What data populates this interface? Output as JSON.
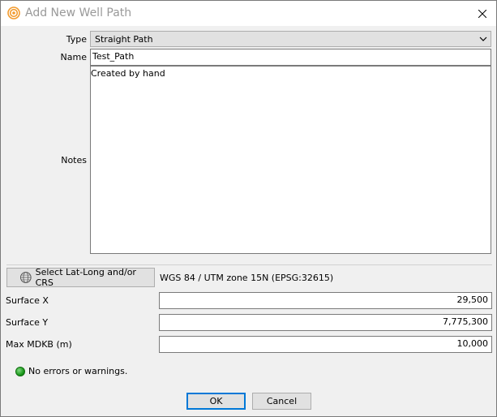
{
  "window": {
    "title": "Add New Well Path",
    "icons": {
      "app": "target-rings-icon",
      "close": "close-x-icon"
    }
  },
  "form": {
    "type_label": "Type",
    "type_value": "Straight Path",
    "name_label": "Name",
    "name_value": "Test_Path",
    "notes_label": "Notes",
    "notes_value": "Created by hand"
  },
  "crs": {
    "button_label": "Select Lat-Long and/or CRS",
    "button_icon": "globe-grid-icon",
    "value": "WGS 84 / UTM zone 15N (EPSG:32615)"
  },
  "coords": {
    "surface_x_label": "Surface X",
    "surface_x_value": "29,500",
    "surface_y_label": "Surface Y",
    "surface_y_value": "7,775,300",
    "max_mdkb_label": "Max MDKB (m)",
    "max_mdkb_value": "10,000"
  },
  "status": {
    "text": "No errors or warnings.",
    "color": "#1c9a1c"
  },
  "buttons": {
    "ok": "OK",
    "cancel": "Cancel"
  },
  "colors": {
    "dialog_bg": "#f0f0f0",
    "accent": "#0078d7",
    "icon_orange": "#f29b2e"
  }
}
